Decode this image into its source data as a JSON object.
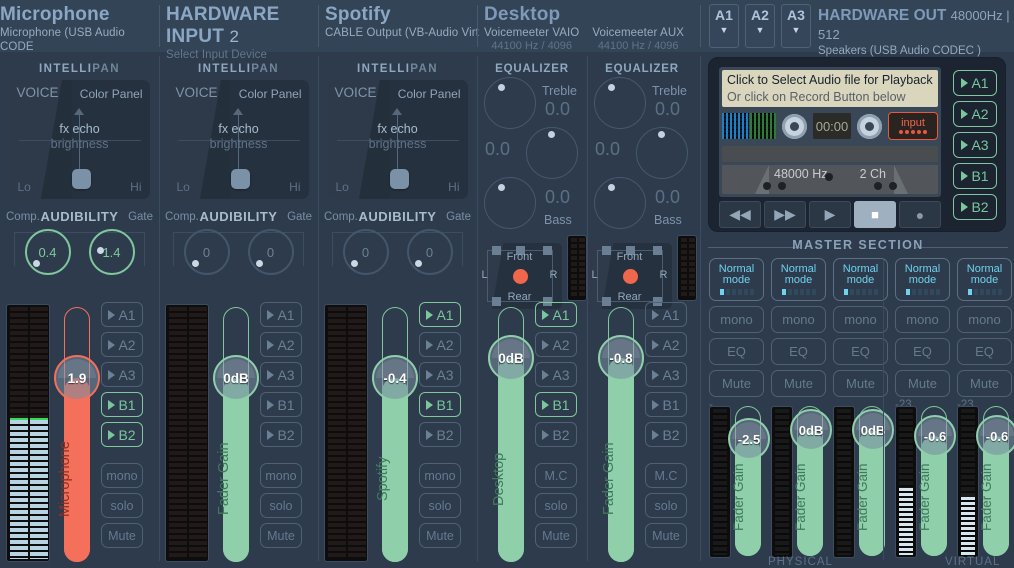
{
  "header": {
    "strips": [
      {
        "title": "Microphone",
        "title_number": "",
        "subtitle": "Microphone (USB Audio CODE",
        "subtitle_dim": false,
        "rate": ""
      },
      {
        "title": "HARDWARE INPUT",
        "title_number": "2",
        "subtitle": "Select Input Device",
        "subtitle_dim": true,
        "rate": ""
      },
      {
        "title": "Spotify",
        "title_number": "",
        "subtitle": "CABLE Output (VB-Audio Virt",
        "subtitle_dim": false,
        "rate": ""
      }
    ],
    "virtual": {
      "title": "Desktop",
      "devices": [
        {
          "name": "Voicemeeter VAIO",
          "rate": "44100 Hz / 4096"
        },
        {
          "name": "Voicemeeter AUX",
          "rate": "44100 Hz / 4096"
        }
      ]
    },
    "out_buttons": [
      "A1",
      "A2",
      "A3"
    ],
    "hardware_out": {
      "label": "HARDWARE OUT",
      "rate": "48000Hz | 512",
      "device": "Speakers (USB Audio CODEC )"
    }
  },
  "intellipan": {
    "title_bold": "INTELLI",
    "title_rest": "PAN",
    "voice_label": "VOICE",
    "color_panel_label": "Color Panel",
    "fx_label": "fx echo",
    "brightness_label": "brightness",
    "lo_label": "Lo",
    "hi_label": "Hi"
  },
  "audibility": {
    "comp_label": "Comp.",
    "title": "AUDIBILITY",
    "gate_label": "Gate"
  },
  "equalizer": {
    "title": "EQUALIZER",
    "treble_label": "Treble",
    "bass_label": "Bass",
    "treble_value": "0.0",
    "mid_value": "0.0",
    "bass_value": "0.0",
    "surround": {
      "front": "Front",
      "rear": "Rear",
      "left": "L",
      "right": "R"
    }
  },
  "input_strips": [
    {
      "name": "Microphone",
      "fader_value": "1.9",
      "fader_pct": 72,
      "fader_color": "red",
      "comp_value": "0.4",
      "comp_on": true,
      "gate_value": "1.4",
      "gate_on": true,
      "meter_level": 55,
      "meter_peak": 55,
      "meter_active": true,
      "routes": [
        {
          "label": "A1",
          "on": false
        },
        {
          "label": "A2",
          "on": false
        },
        {
          "label": "A3",
          "on": false
        },
        {
          "label": "B1",
          "on": true
        },
        {
          "label": "B2",
          "on": true
        }
      ],
      "mono_label": "mono",
      "solo_label": "solo",
      "mute_label": "Mute"
    },
    {
      "name": "Fader Gain",
      "fader_value": "0dB",
      "fader_pct": 72,
      "fader_color": "green",
      "comp_value": "0",
      "comp_on": false,
      "gate_value": "0",
      "gate_on": false,
      "meter_level": 0,
      "meter_peak": 0,
      "meter_active": false,
      "routes": [
        {
          "label": "A1",
          "on": false
        },
        {
          "label": "A2",
          "on": false
        },
        {
          "label": "A3",
          "on": false
        },
        {
          "label": "B1",
          "on": false
        },
        {
          "label": "B2",
          "on": false
        }
      ],
      "mono_label": "mono",
      "solo_label": "solo",
      "mute_label": "Mute"
    },
    {
      "name": "Spotify",
      "fader_value": "-0.4",
      "fader_pct": 72,
      "fader_color": "green",
      "comp_value": "0",
      "comp_on": false,
      "gate_value": "0",
      "gate_on": false,
      "meter_level": 0,
      "meter_peak": 0,
      "meter_active": false,
      "routes": [
        {
          "label": "A1",
          "on": true
        },
        {
          "label": "A2",
          "on": false
        },
        {
          "label": "A3",
          "on": false
        },
        {
          "label": "B1",
          "on": true
        },
        {
          "label": "B2",
          "on": false
        }
      ],
      "mono_label": "mono",
      "solo_label": "solo",
      "mute_label": "Mute"
    }
  ],
  "virtual_strips": [
    {
      "name": "Desktop",
      "fader_value": "0dB",
      "fader_pct": 80,
      "meter_level": 0,
      "routes": [
        {
          "label": "A1",
          "on": true
        },
        {
          "label": "A2",
          "on": false
        },
        {
          "label": "A3",
          "on": false
        },
        {
          "label": "B1",
          "on": true
        },
        {
          "label": "B2",
          "on": false
        }
      ],
      "mc_label": "M.C",
      "solo_label": "solo",
      "mute_label": "Mute"
    },
    {
      "name": "Fader Gain",
      "fader_value": "-0.8",
      "fader_pct": 80,
      "meter_level": 0,
      "routes": [
        {
          "label": "A1",
          "on": false
        },
        {
          "label": "A2",
          "on": false
        },
        {
          "label": "A3",
          "on": false
        },
        {
          "label": "B1",
          "on": false
        },
        {
          "label": "B2",
          "on": false
        }
      ],
      "mc_label": "M.C",
      "solo_label": "solo",
      "mute_label": "Mute"
    }
  ],
  "recorder": {
    "file_line1": "Click to Select Audio file for Playback",
    "file_line2": "Or click on Record Button below",
    "time": "00:00",
    "input_label": "input",
    "sample_rate": "48000 Hz",
    "channels": "2 Ch",
    "transport": [
      {
        "name": "rewind",
        "glyph": "◀◀",
        "active": false
      },
      {
        "name": "forward",
        "glyph": "▶▶",
        "active": false
      },
      {
        "name": "play",
        "glyph": "▶",
        "active": false
      },
      {
        "name": "stop",
        "glyph": "■",
        "active": true
      },
      {
        "name": "record",
        "glyph": "●",
        "active": false
      }
    ],
    "routes": [
      {
        "label": "A1",
        "on": true
      },
      {
        "label": "A2",
        "on": true
      },
      {
        "label": "A3",
        "on": true
      },
      {
        "label": "B1",
        "on": true
      },
      {
        "label": "B2",
        "on": true
      }
    ]
  },
  "master": {
    "title": "MASTER SECTION",
    "physical_label": "PHYSICAL",
    "virtual_label": "VIRTUAL",
    "buses": [
      {
        "id": "A1",
        "mode_line1": "Normal",
        "mode_line2": "mode",
        "leds_on": 1,
        "mono_label": "mono",
        "eq_label": "EQ",
        "mute_label": "Mute",
        "gain_label": "-",
        "fader_value": "-2.5",
        "fader_pct": 78,
        "name": "Fader Gain",
        "meter_level": 0,
        "virtual": false
      },
      {
        "id": "A2",
        "mode_line1": "Normal",
        "mode_line2": "mode",
        "leds_on": 1,
        "mono_label": "mono",
        "eq_label": "EQ",
        "mute_label": "Mute",
        "gain_label": "",
        "fader_value": "0dB",
        "fader_pct": 84,
        "name": "Fader Gain",
        "meter_level": 0,
        "virtual": false
      },
      {
        "id": "A3",
        "mode_line1": "Normal",
        "mode_line2": "mode",
        "leds_on": 1,
        "mono_label": "mono",
        "eq_label": "EQ",
        "mute_label": "Mute",
        "gain_label": "",
        "fader_value": "0dB",
        "fader_pct": 84,
        "name": "Fader Gain",
        "meter_level": 0,
        "virtual": false
      },
      {
        "id": "B1",
        "mode_line1": "Normal",
        "mode_line2": "mode",
        "leds_on": 1,
        "mono_label": "mono",
        "eq_label": "EQ",
        "mute_label": "Mute",
        "gain_label": "-23",
        "fader_value": "-0.6",
        "fader_pct": 80,
        "name": "Fader Gain",
        "meter_level": 46,
        "virtual": true
      },
      {
        "id": "B2",
        "mode_line1": "Normal",
        "mode_line2": "mode",
        "leds_on": 1,
        "mono_label": "mono",
        "eq_label": "EQ",
        "mute_label": "Mute",
        "gain_label": "-23",
        "fader_value": "-0.6",
        "fader_pct": 80,
        "name": "Fader Gain",
        "meter_level": 40,
        "virtual": true
      }
    ]
  },
  "colors": {
    "background": "#2d3b4d",
    "header": "#344457",
    "accent_green": "#7fc79c",
    "accent_red": "#f4705a",
    "accent_cyan": "#6fd2ef",
    "text": "#8fa6bd"
  }
}
